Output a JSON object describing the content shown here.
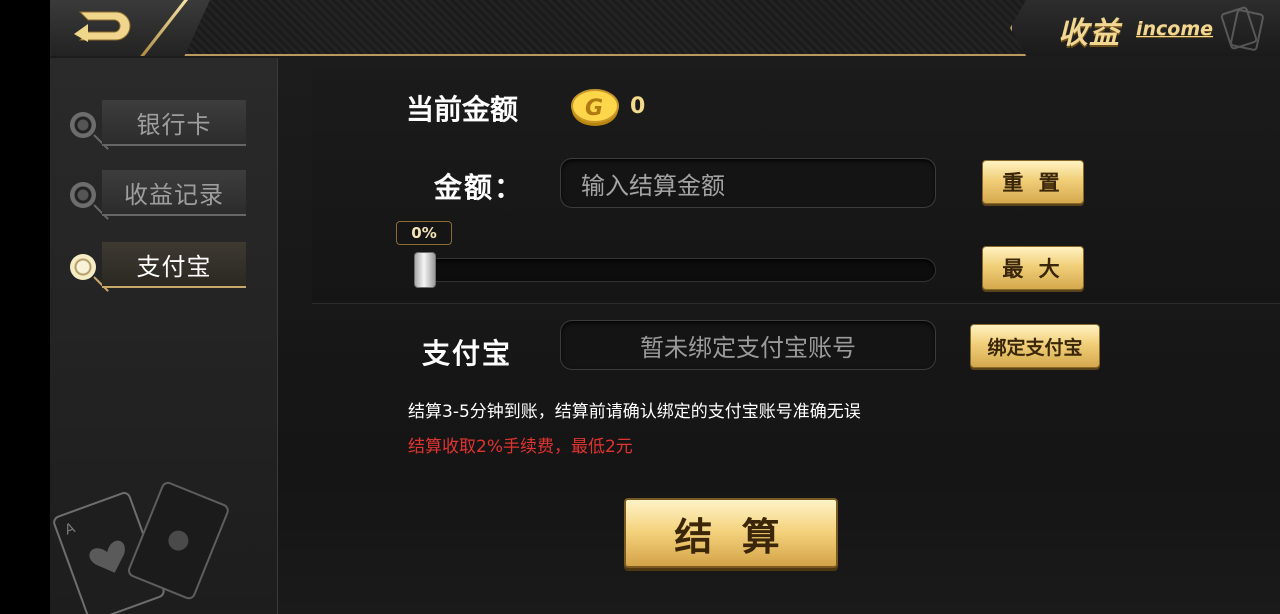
{
  "header": {
    "title": "收益",
    "subtitle": "income"
  },
  "sidebar": {
    "items": [
      {
        "label": "银行卡",
        "active": false
      },
      {
        "label": "收益记录",
        "active": false
      },
      {
        "label": "支付宝",
        "active": true
      }
    ]
  },
  "balance": {
    "label": "当前金额",
    "value": "0"
  },
  "amount": {
    "label": "金额：",
    "placeholder": "输入结算金额",
    "reset_label": "重 置",
    "max_label": "最 大"
  },
  "slider": {
    "percent_label": "0%",
    "value_percent": 0
  },
  "alipay": {
    "label": "支付宝",
    "account_text": "暂未绑定支付宝账号",
    "bind_label": "绑定支付宝",
    "watermark_glyph": "支"
  },
  "notes": {
    "info": "结算3-5分钟到账，结算前请确认绑定的支付宝账号准确无误",
    "fee": "结算收取2%手续费，最低2元"
  },
  "settle_label": "结 算",
  "colors": {
    "gold": "#f1cf79",
    "fee_red": "#e1332f",
    "background": "#1a1a1a"
  }
}
